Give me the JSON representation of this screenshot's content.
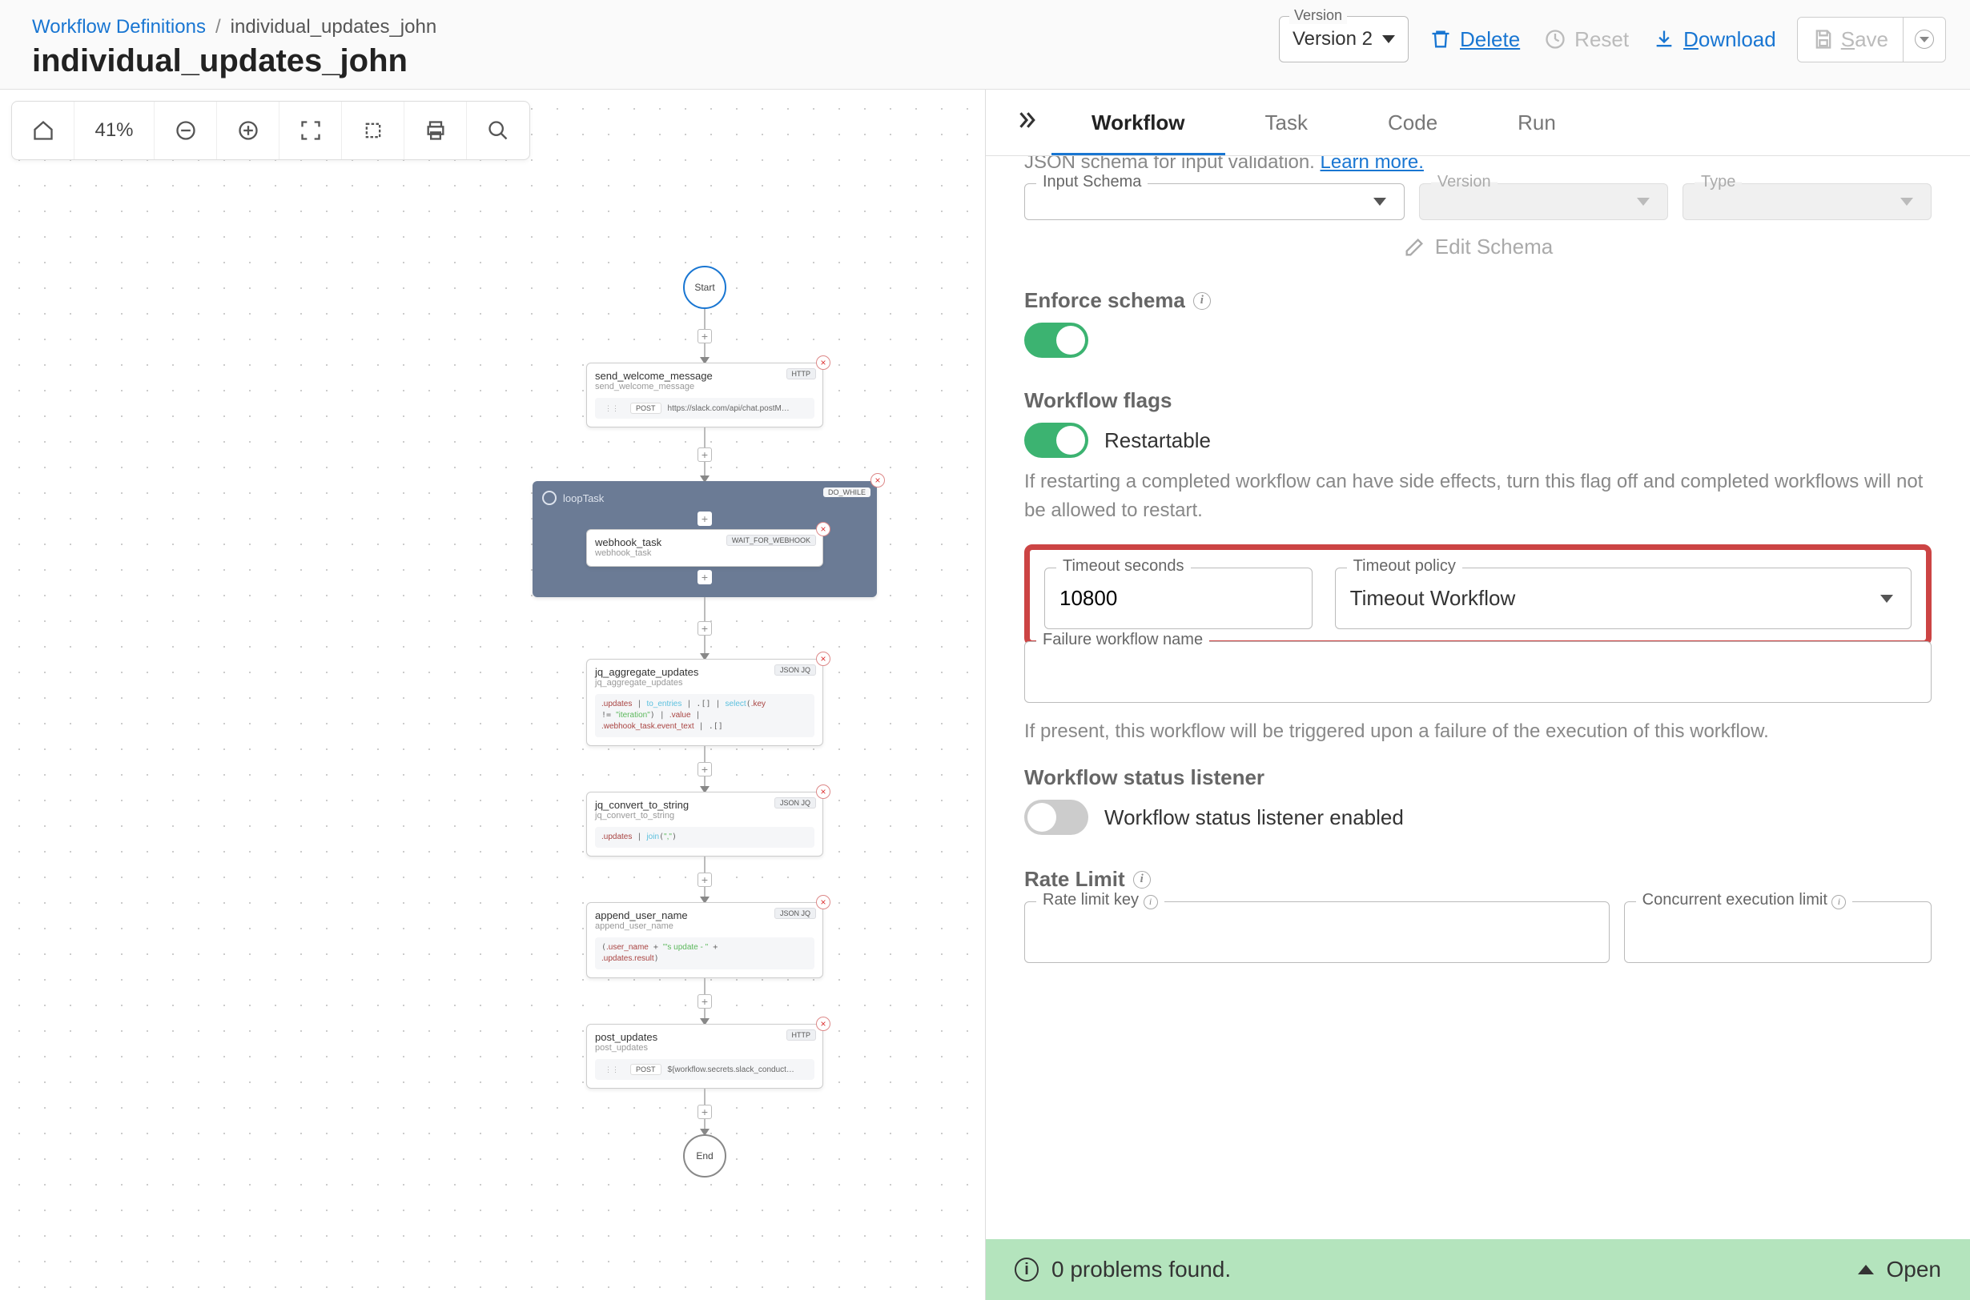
{
  "breadcrumb": {
    "root": "Workflow Definitions",
    "current": "individual_updates_john"
  },
  "page_title": "individual_updates_john",
  "version": {
    "label": "Version",
    "value": "Version 2"
  },
  "actions": {
    "delete": "Delete",
    "reset": "Reset",
    "download": "Download",
    "save": "Save"
  },
  "toolbar": {
    "zoom": "41%"
  },
  "diagram": {
    "start": "Start",
    "end": "End",
    "nodes": [
      {
        "title": "send_welcome_message",
        "sub": "send_welcome_message",
        "badge": "HTTP",
        "pill_method": "POST",
        "pill_url": "https://slack.com/api/chat.postM…"
      },
      {
        "loop_title": "loopTask",
        "loop_badge": "DO_WHILE",
        "inner_title": "webhook_task",
        "inner_sub": "webhook_task",
        "inner_badge": "WAIT_FOR_WEBHOOK"
      },
      {
        "title": "jq_aggregate_updates",
        "sub": "jq_aggregate_updates",
        "badge": "JSON JQ",
        "code": ".updates | to_entries | .[] | select(.key != \"iteration\") | .value | .webhook_task.event_text | .[]"
      },
      {
        "title": "jq_convert_to_string",
        "sub": "jq_convert_to_string",
        "badge": "JSON JQ",
        "code": ".updates | join(\",\")"
      },
      {
        "title": "append_user_name",
        "sub": "append_user_name",
        "badge": "JSON JQ",
        "code": "(.user_name + \"'s update - \" + .updates.result)"
      },
      {
        "title": "post_updates",
        "sub": "post_updates",
        "badge": "HTTP",
        "pill_method": "POST",
        "pill_url": "${workflow.secrets.slack_conduct…"
      }
    ]
  },
  "tabs": {
    "workflow": "Workflow",
    "task": "Task",
    "code": "Code",
    "run": "Run"
  },
  "panel": {
    "schema_hint_prefix": "JSON schema for input validation. ",
    "schema_hint_link": "Learn more.",
    "input_schema_label": "Input Schema",
    "version_label": "Version",
    "type_label": "Type",
    "edit_schema": "Edit Schema",
    "enforce_schema": "Enforce schema",
    "workflow_flags": "Workflow flags",
    "restartable": "Restartable",
    "restart_help": "If restarting a completed workflow can have side effects, turn this flag off and completed workflows will not be allowed to restart.",
    "timeout_seconds_label": "Timeout seconds",
    "timeout_seconds_value": "10800",
    "timeout_policy_label": "Timeout policy",
    "timeout_policy_value": "Timeout Workflow",
    "failure_name_label": "Failure workflow name",
    "failure_help": "If present, this workflow will be triggered upon a failure of the execution of this workflow.",
    "status_listener": "Workflow status listener",
    "status_listener_label": "Workflow status listener enabled",
    "rate_limit": "Rate Limit",
    "rate_limit_key_label": "Rate limit key",
    "concurrent_label": "Concurrent execution limit"
  },
  "problems": {
    "count_text": "0 problems found.",
    "open": "Open"
  }
}
